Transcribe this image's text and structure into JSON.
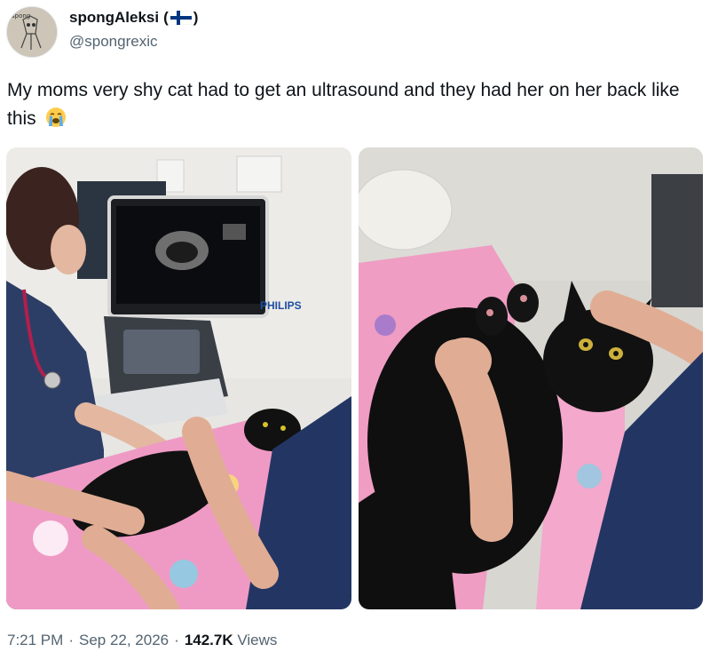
{
  "author": {
    "display_name": "spongAleksi",
    "flag_paren_open": "(",
    "flag_paren_close": ")",
    "flag": "finland-flag-icon",
    "handle": "@spongrexic",
    "avatar": "sketch-avatar"
  },
  "tweet": {
    "text": "My moms very shy cat had to get an ultrasound and they had her on her back like this",
    "emoji": "loudly-crying-face-icon"
  },
  "media": {
    "left_monitor_brand": "PHILIPS",
    "photos": [
      "ultrasound-room-photo",
      "cat-on-back-closeup-photo"
    ]
  },
  "meta": {
    "time": "7:21 PM",
    "date": "Sep 22, 2026",
    "views_count": "142.7K",
    "views_label": "Views"
  },
  "colors": {
    "text": "#0f1419",
    "muted": "#536471",
    "flag_blue": "#003580"
  }
}
